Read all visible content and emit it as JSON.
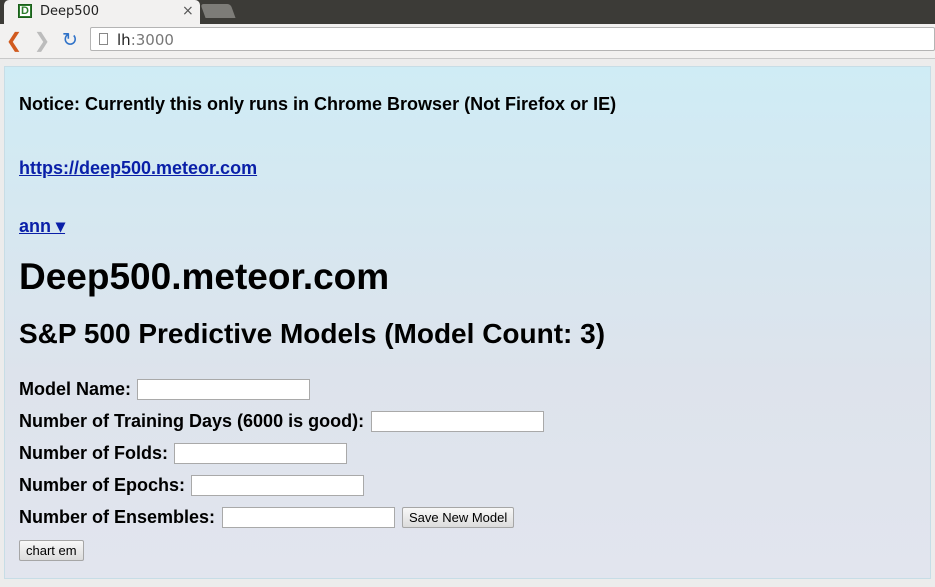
{
  "browser": {
    "tab_title": "Deep500",
    "tab_favicon_letter": "D",
    "close_glyph": "×",
    "url_host": "lh",
    "url_port": ":3000"
  },
  "page": {
    "notice": "Notice: Currently this only runs in Chrome Browser (Not Firefox or IE)",
    "site_link": "https://deep500.meteor.com ",
    "user_menu": "ann ▾",
    "site_title": "Deep500.meteor.com",
    "subtitle": "S&P 500 Predictive Models (Model Count: 3)"
  },
  "form": {
    "model_name_label": "Model Name:",
    "model_name_value": "",
    "training_days_label": "Number of Training Days (6000 is good):",
    "training_days_value": "",
    "folds_label": "Number of Folds:",
    "folds_value": "",
    "epochs_label": "Number of Epochs:",
    "epochs_value": "",
    "ensembles_label": "Number of Ensembles:",
    "ensembles_value": "",
    "save_button": "Save New Model",
    "chart_button": "chart em"
  }
}
